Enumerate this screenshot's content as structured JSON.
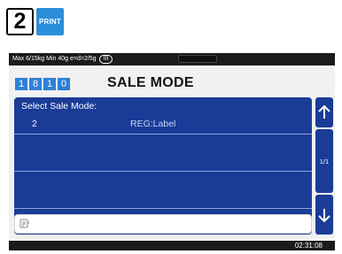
{
  "keys": {
    "number": "2",
    "print": "PRINT"
  },
  "topbar": {
    "spec": "Max 6/15kg Min 40g e=d=2/5g",
    "class": "III"
  },
  "code_digits": [
    "1",
    "8",
    "1",
    "0"
  ],
  "mode_title": "SALE MODE",
  "panel": {
    "header": "Select Sale Mode:",
    "rows": [
      {
        "number": "2",
        "label": "REG:Label"
      },
      {
        "number": "",
        "label": ""
      },
      {
        "number": "",
        "label": ""
      }
    ]
  },
  "pager": "1/1",
  "icons": {
    "up": "arrow-up-icon",
    "down": "arrow-down-icon",
    "input": "keyboard-input-icon"
  },
  "status": {
    "time": "02:31:08"
  },
  "colors": {
    "panel": "#1a3c97",
    "digit": "#2f7fd6",
    "print_key": "#2a8fd8",
    "bar": "#1b1b1b"
  }
}
